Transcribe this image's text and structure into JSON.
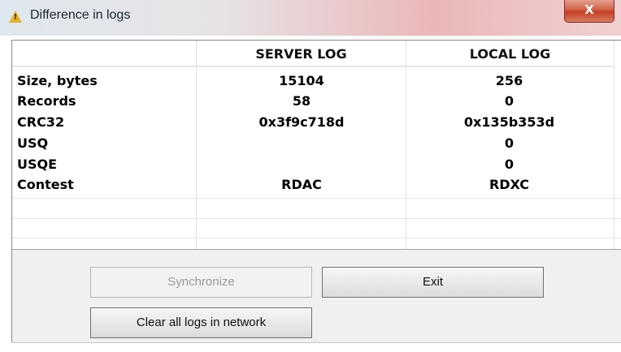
{
  "window": {
    "title": "Difference in logs",
    "close_label": "X"
  },
  "icons": {
    "title_icon": "warning-icon",
    "title_icon_mark": "!"
  },
  "table": {
    "columns": [
      "",
      "SERVER LOG",
      "LOCAL LOG"
    ],
    "rows": [
      {
        "name": "Size, bytes",
        "server": "15104",
        "local": "256"
      },
      {
        "name": "Records",
        "server": "58",
        "local": "0"
      },
      {
        "name": "CRC32",
        "server": "0x3f9c718d",
        "local": "0x135b353d"
      },
      {
        "name": "USQ",
        "server": "",
        "local": "0"
      },
      {
        "name": "USQE",
        "server": "",
        "local": "0"
      },
      {
        "name": "Contest",
        "server": "RDAC",
        "local": "RDXC"
      }
    ]
  },
  "buttons": {
    "synchronize": "Synchronize",
    "exit": "Exit",
    "clear_all": "Clear all logs in network"
  },
  "colors": {
    "warning": "#e6b229",
    "close": "#c63f25"
  }
}
